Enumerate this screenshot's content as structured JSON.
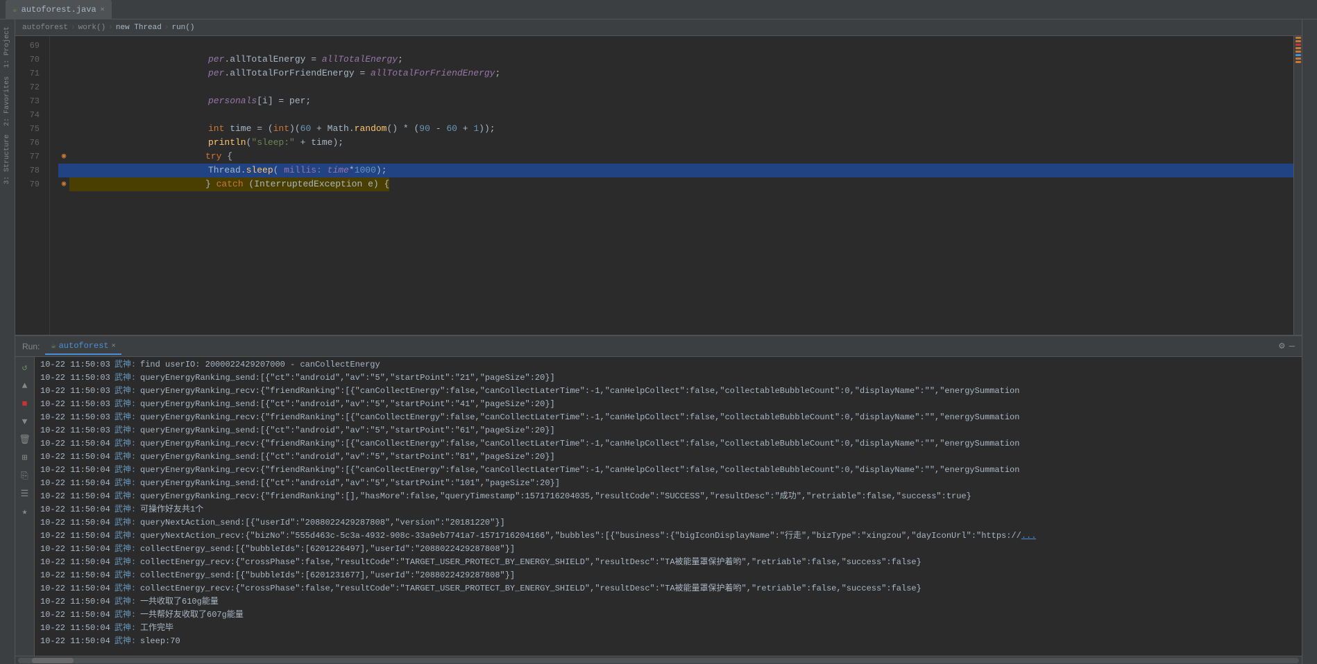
{
  "tab": {
    "label": "autoforest.java",
    "icon": "☕"
  },
  "breadcrumb": {
    "items": [
      "autoforest",
      "work()",
      "new Thread",
      "run()"
    ]
  },
  "code": {
    "startLine": 69,
    "lines": [
      {
        "num": 69,
        "content": "",
        "type": "blank"
      },
      {
        "num": 70,
        "content": "            per.allTotalEnergy = allTotalEnergy;",
        "type": "code"
      },
      {
        "num": 71,
        "content": "            per.allTotalForFriendEnergy = allTotalForFriendEnergy;",
        "type": "code"
      },
      {
        "num": 72,
        "content": "",
        "type": "blank"
      },
      {
        "num": 73,
        "content": "            personals[i] = per;",
        "type": "code"
      },
      {
        "num": 74,
        "content": "",
        "type": "blank"
      },
      {
        "num": 75,
        "content": "            int time = (int)(60 + Math.random() * (90 - 60 + 1));",
        "type": "code"
      },
      {
        "num": 76,
        "content": "            println(\"sleep:\" + time);",
        "type": "code"
      },
      {
        "num": 77,
        "content": "            try {",
        "type": "code",
        "hasGutter": true
      },
      {
        "num": 78,
        "content": "                Thread.sleep( millis: time*1000);",
        "type": "code",
        "selected": true
      },
      {
        "num": 79,
        "content": "            } catch (InterruptedException e) {",
        "type": "code",
        "hasGutter": true
      }
    ]
  },
  "run": {
    "label": "Run:",
    "tab": "autoforest",
    "logs": [
      {
        "time": "10-22 11:50:03",
        "tag": "武神:",
        "msg": "find userIO: 2000022429207000 - canCollectEnergy"
      },
      {
        "time": "10-22 11:50:03",
        "tag": "武神:",
        "msg": "queryEnergyRanking_send:[{\"ct\":\"android\",\"av\":\"5\",\"startPoint\":\"21\",\"pageSize\":20}]"
      },
      {
        "time": "10-22 11:50:03",
        "tag": "武神:",
        "msg": "queryEnergyRanking_recv:{\"friendRanking\":[{\"canCollectEnergy\":false,\"canCollectLaterTime\":-1,\"canHelpCollect\":false,\"collectableBubbleCount\":0,\"displayName\":\"\",\"energySummation"
      },
      {
        "time": "10-22 11:50:03",
        "tag": "武神:",
        "msg": "queryEnergyRanking_send:[{\"ct\":\"android\",\"av\":\"5\",\"startPoint\":\"41\",\"pageSize\":20}]"
      },
      {
        "time": "10-22 11:50:03",
        "tag": "武神:",
        "msg": "queryEnergyRanking_recv:{\"friendRanking\":[{\"canCollectEnergy\":false,\"canCollectLaterTime\":-1,\"canHelpCollect\":false,\"collectableBubbleCount\":0,\"displayName\":\"\",\"energySummation"
      },
      {
        "time": "10-22 11:50:03",
        "tag": "武神:",
        "msg": "queryEnergyRanking_send:[{\"ct\":\"android\",\"av\":\"5\",\"startPoint\":\"61\",\"pageSize\":20}]"
      },
      {
        "time": "10-22 11:50:04",
        "tag": "武神:",
        "msg": "queryEnergyRanking_recv:{\"friendRanking\":[{\"canCollectEnergy\":false,\"canCollectLaterTime\":-1,\"canHelpCollect\":false,\"collectableBubbleCount\":0,\"displayName\":\"\",\"energySummation"
      },
      {
        "time": "10-22 11:50:04",
        "tag": "武神:",
        "msg": "queryEnergyRanking_send:[{\"ct\":\"android\",\"av\":\"5\",\"startPoint\":\"81\",\"pageSize\":20}]"
      },
      {
        "time": "10-22 11:50:04",
        "tag": "武神:",
        "msg": "queryEnergyRanking_recv:{\"friendRanking\":[{\"canCollectEnergy\":false,\"canCollectLaterTime\":-1,\"canHelpCollect\":false,\"collectableBubbleCount\":0,\"displayName\":\"\",\"energySummation"
      },
      {
        "time": "10-22 11:50:04",
        "tag": "武神:",
        "msg": "queryEnergyRanking_send:[{\"ct\":\"android\",\"av\":\"5\",\"startPoint\":\"101\",\"pageSize\":20}]"
      },
      {
        "time": "10-22 11:50:04",
        "tag": "武神:",
        "msg": "queryEnergyRanking_recv:{\"friendRanking\":[],\"hasMore\":false,\"queryTimestamp\":1571716204035,\"resultCode\":\"SUCCESS\",\"resultDesc\":\"成功\",\"retriable\":false,\"success\":true}"
      },
      {
        "time": "10-22 11:50:04",
        "tag": "武神:",
        "msg": "可操作好友共1个",
        "chinese": true
      },
      {
        "time": "10-22 11:50:04",
        "tag": "武神:",
        "msg": "queryNextAction_send:[{\"userId\":\"2088022429287808\",\"version\":\"20181220\"}]"
      },
      {
        "time": "10-22 11:50:04",
        "tag": "武神:",
        "msg": "queryNextAction_recv:{\"bizNo\":\"555d463c-5c3a-4932-908c-33a9eb7741a7-1571716204166\",\"bubbles\":[{\"business\":{\"bigIconDisplayName\":\"行走\",\"bizType\":\"xingzou\",\"dayIconUrl\":\"https://",
        "hasLink": true
      },
      {
        "time": "10-22 11:50:04",
        "tag": "武神:",
        "msg": "collectEnergy_send:[{\"bubbleIds\":[6201226497],\"userId\":\"2088022429287808\"}]"
      },
      {
        "time": "10-22 11:50:04",
        "tag": "武神:",
        "msg": "collectEnergy_recv:{\"crossPhase\":false,\"resultCode\":\"TARGET_USER_PROTECT_BY_ENERGY_SHIELD\",\"resultDesc\":\"TA被能量罩保护着哟\",\"retriable\":false,\"success\":false}"
      },
      {
        "time": "10-22 11:50:04",
        "tag": "武神:",
        "msg": "collectEnergy_send:[{\"bubbleIds\":[6201231677],\"userId\":\"2088022429287808\"}]"
      },
      {
        "time": "10-22 11:50:04",
        "tag": "武神:",
        "msg": "collectEnergy_recv:{\"crossPhase\":false,\"resultCode\":\"TARGET_USER_PROTECT_BY_ENERGY_SHIELD\",\"resultDesc\":\"TA被能量罩保护着哟\",\"retriable\":false,\"success\":false}"
      },
      {
        "time": "10-22 11:50:04",
        "tag": "武神:",
        "msg": "一共收取了610g能量",
        "chinese": true
      },
      {
        "time": "10-22 11:50:04",
        "tag": "武神:",
        "msg": "一共帮好友收取了607g能量",
        "chinese": true
      },
      {
        "time": "10-22 11:50:04",
        "tag": "武神:",
        "msg": "工作完毕",
        "chinese": true
      },
      {
        "time": "10-22 11:50:04",
        "tag": "武神:",
        "msg": "sleep:70"
      }
    ]
  },
  "sidebar": {
    "leftTabs": [
      "1: Project",
      "2: Favorites",
      "3: Structure"
    ]
  },
  "rightPanel": {
    "scrollMarkers": 8
  }
}
